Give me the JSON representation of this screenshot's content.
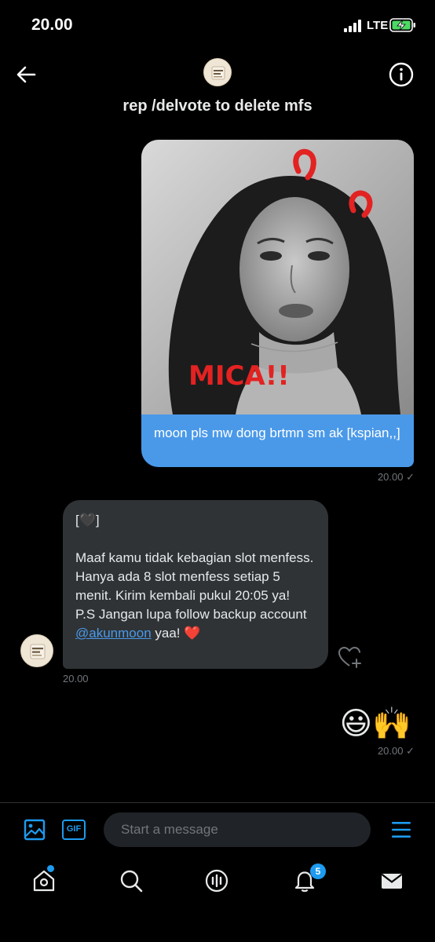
{
  "status_bar": {
    "time": "20.00",
    "network": "LTE"
  },
  "header": {
    "title": "rep /delvote to delete mfs"
  },
  "conversation": {
    "sent_image": {
      "caption": "moon pls mw dong brtmn sm ak [kspian,,]",
      "time": "20.00 ✓"
    },
    "received": {
      "lines": [
        "[🖤]",
        "",
        "Maaf kamu tidak kebagian slot menfess.  Hanya ada 8 slot menfess setiap 5 menit. Kirim kembali pukul 20:05 ya!",
        "P.S Jangan lupa follow backup account "
      ],
      "mention": "@akunmoon",
      "tail": " yaa! ❤️",
      "time": "20.00"
    },
    "sent_emoji": {
      "text": "😃🙌",
      "time": "20.00 ✓"
    }
  },
  "composer": {
    "placeholder": "Start a message",
    "gif_label": "GIF"
  },
  "bottom_nav": {
    "notification_count": "5"
  },
  "colors": {
    "accent": "#1d9bf0",
    "sent_bubble": "#4a99e9",
    "received_bubble": "#2f3336",
    "background": "#000000"
  }
}
